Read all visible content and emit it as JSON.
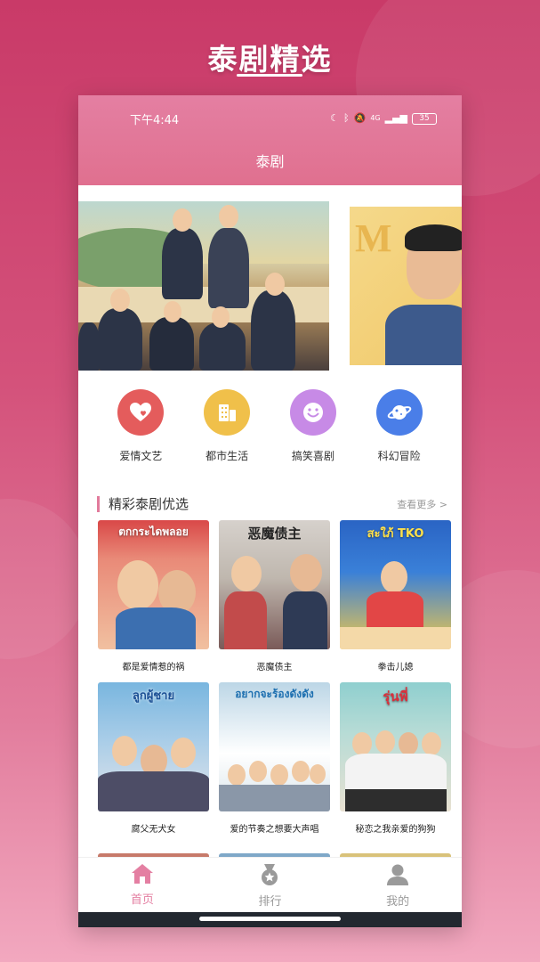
{
  "promo": {
    "title": "泰剧精选"
  },
  "status_bar": {
    "time": "下午4:44",
    "network": "4G",
    "battery": "35"
  },
  "header": {
    "title": "泰剧"
  },
  "categories": [
    {
      "label": "爱情文艺",
      "icon": "heart-icon",
      "color": "#e45c5c"
    },
    {
      "label": "都市生活",
      "icon": "building-icon",
      "color": "#f0c04a"
    },
    {
      "label": "搞笑喜剧",
      "icon": "smile-icon",
      "color": "#c78ae6"
    },
    {
      "label": "科幻冒险",
      "icon": "planet-icon",
      "color": "#4a7ee8"
    }
  ],
  "section": {
    "title": "精彩泰剧优选",
    "more": "查看更多 >"
  },
  "dramas": [
    {
      "title": "都是爱情惹的祸",
      "poster_text": "ตกกระไดพลอย",
      "colors": [
        "#d94848",
        "#f1c0a0"
      ]
    },
    {
      "title": "恶魔债主",
      "poster_text": "恶魔债主",
      "colors": [
        "#c9c4bf",
        "#7a5a58"
      ]
    },
    {
      "title": "拳击儿媳",
      "poster_text": "สะใภ้ TKO",
      "colors": [
        "#2a64c4",
        "#f2c948"
      ]
    },
    {
      "title": "腐父无犬女",
      "poster_text": "ลูกผู้ชาย",
      "colors": [
        "#79b6df",
        "#e5e6ea"
      ]
    },
    {
      "title": "爱的节奏之想要大声唱",
      "poster_text": "อยากจะร้องดังดัง",
      "colors": [
        "#bcd6e6",
        "#ffffff"
      ]
    },
    {
      "title": "秘恋之我亲爱的狗狗",
      "poster_text": "รุ่นพี่",
      "colors": [
        "#8fcfcf",
        "#e8e1d2"
      ]
    }
  ],
  "tabs": [
    {
      "label": "首页",
      "icon": "home-icon",
      "active": true
    },
    {
      "label": "排行",
      "icon": "medal-icon",
      "active": false
    },
    {
      "label": "我的",
      "icon": "user-icon",
      "active": false
    }
  ],
  "colors": {
    "accent": "#e27b9c",
    "tab_active": "#e47fa2",
    "tab_inactive": "#9a9a9a"
  }
}
